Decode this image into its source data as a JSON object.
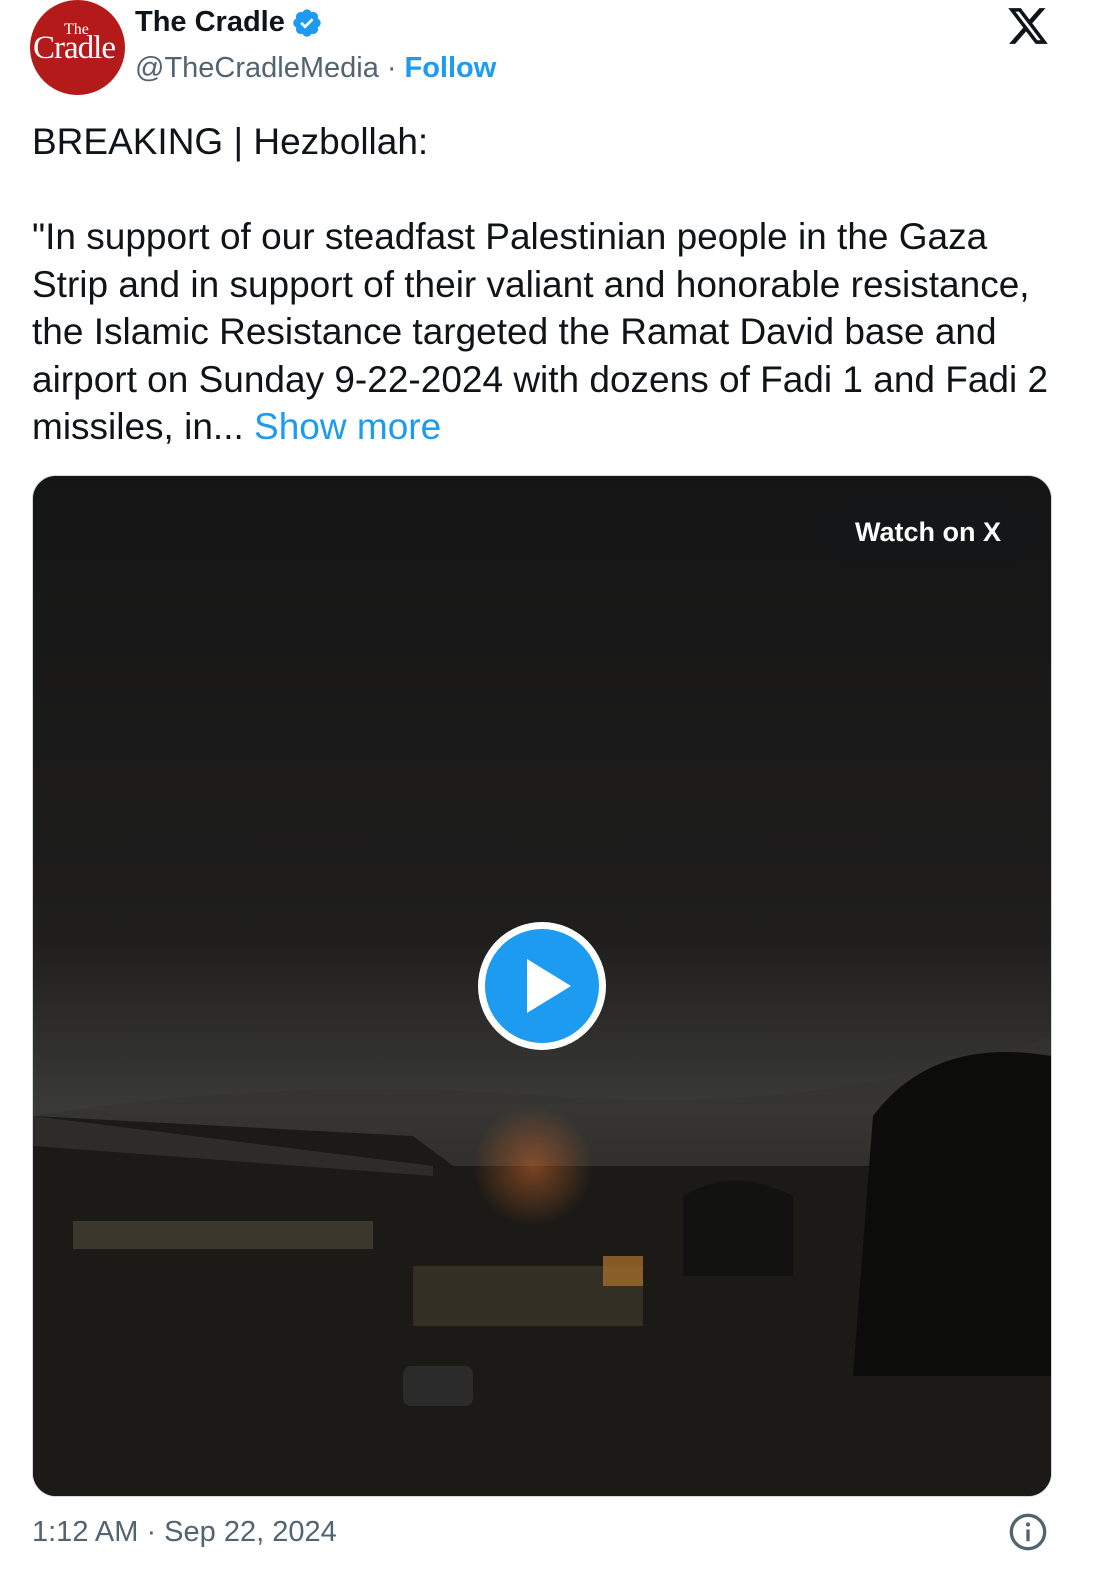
{
  "author": {
    "display_name": "The Cradle",
    "handle": "@TheCradleMedia",
    "separator": "·",
    "follow_label": "Follow",
    "verified": true,
    "avatar_logo_top": "The",
    "avatar_logo_main": "Cradle"
  },
  "tweet": {
    "text_main": "BREAKING | Hezbollah:\n\n\"In support of our steadfast Palestinian people in the Gaza Strip and in support of their valiant and honorable resistance, the Islamic Resistance targeted the Ramat David base and airport on Sunday 9-22-2024 with dozens of Fadi 1 and Fadi 2 missiles, in... ",
    "show_more_label": "Show more"
  },
  "media": {
    "watch_label": "Watch on X",
    "play_icon": "play-icon"
  },
  "footer": {
    "timestamp": "1:12 AM · Sep 22, 2024",
    "info_icon": "info-icon"
  },
  "colors": {
    "accent": "#1d9bf0",
    "brand_red": "#b51a1a",
    "text_primary": "#0f1419",
    "text_secondary": "#536471"
  }
}
